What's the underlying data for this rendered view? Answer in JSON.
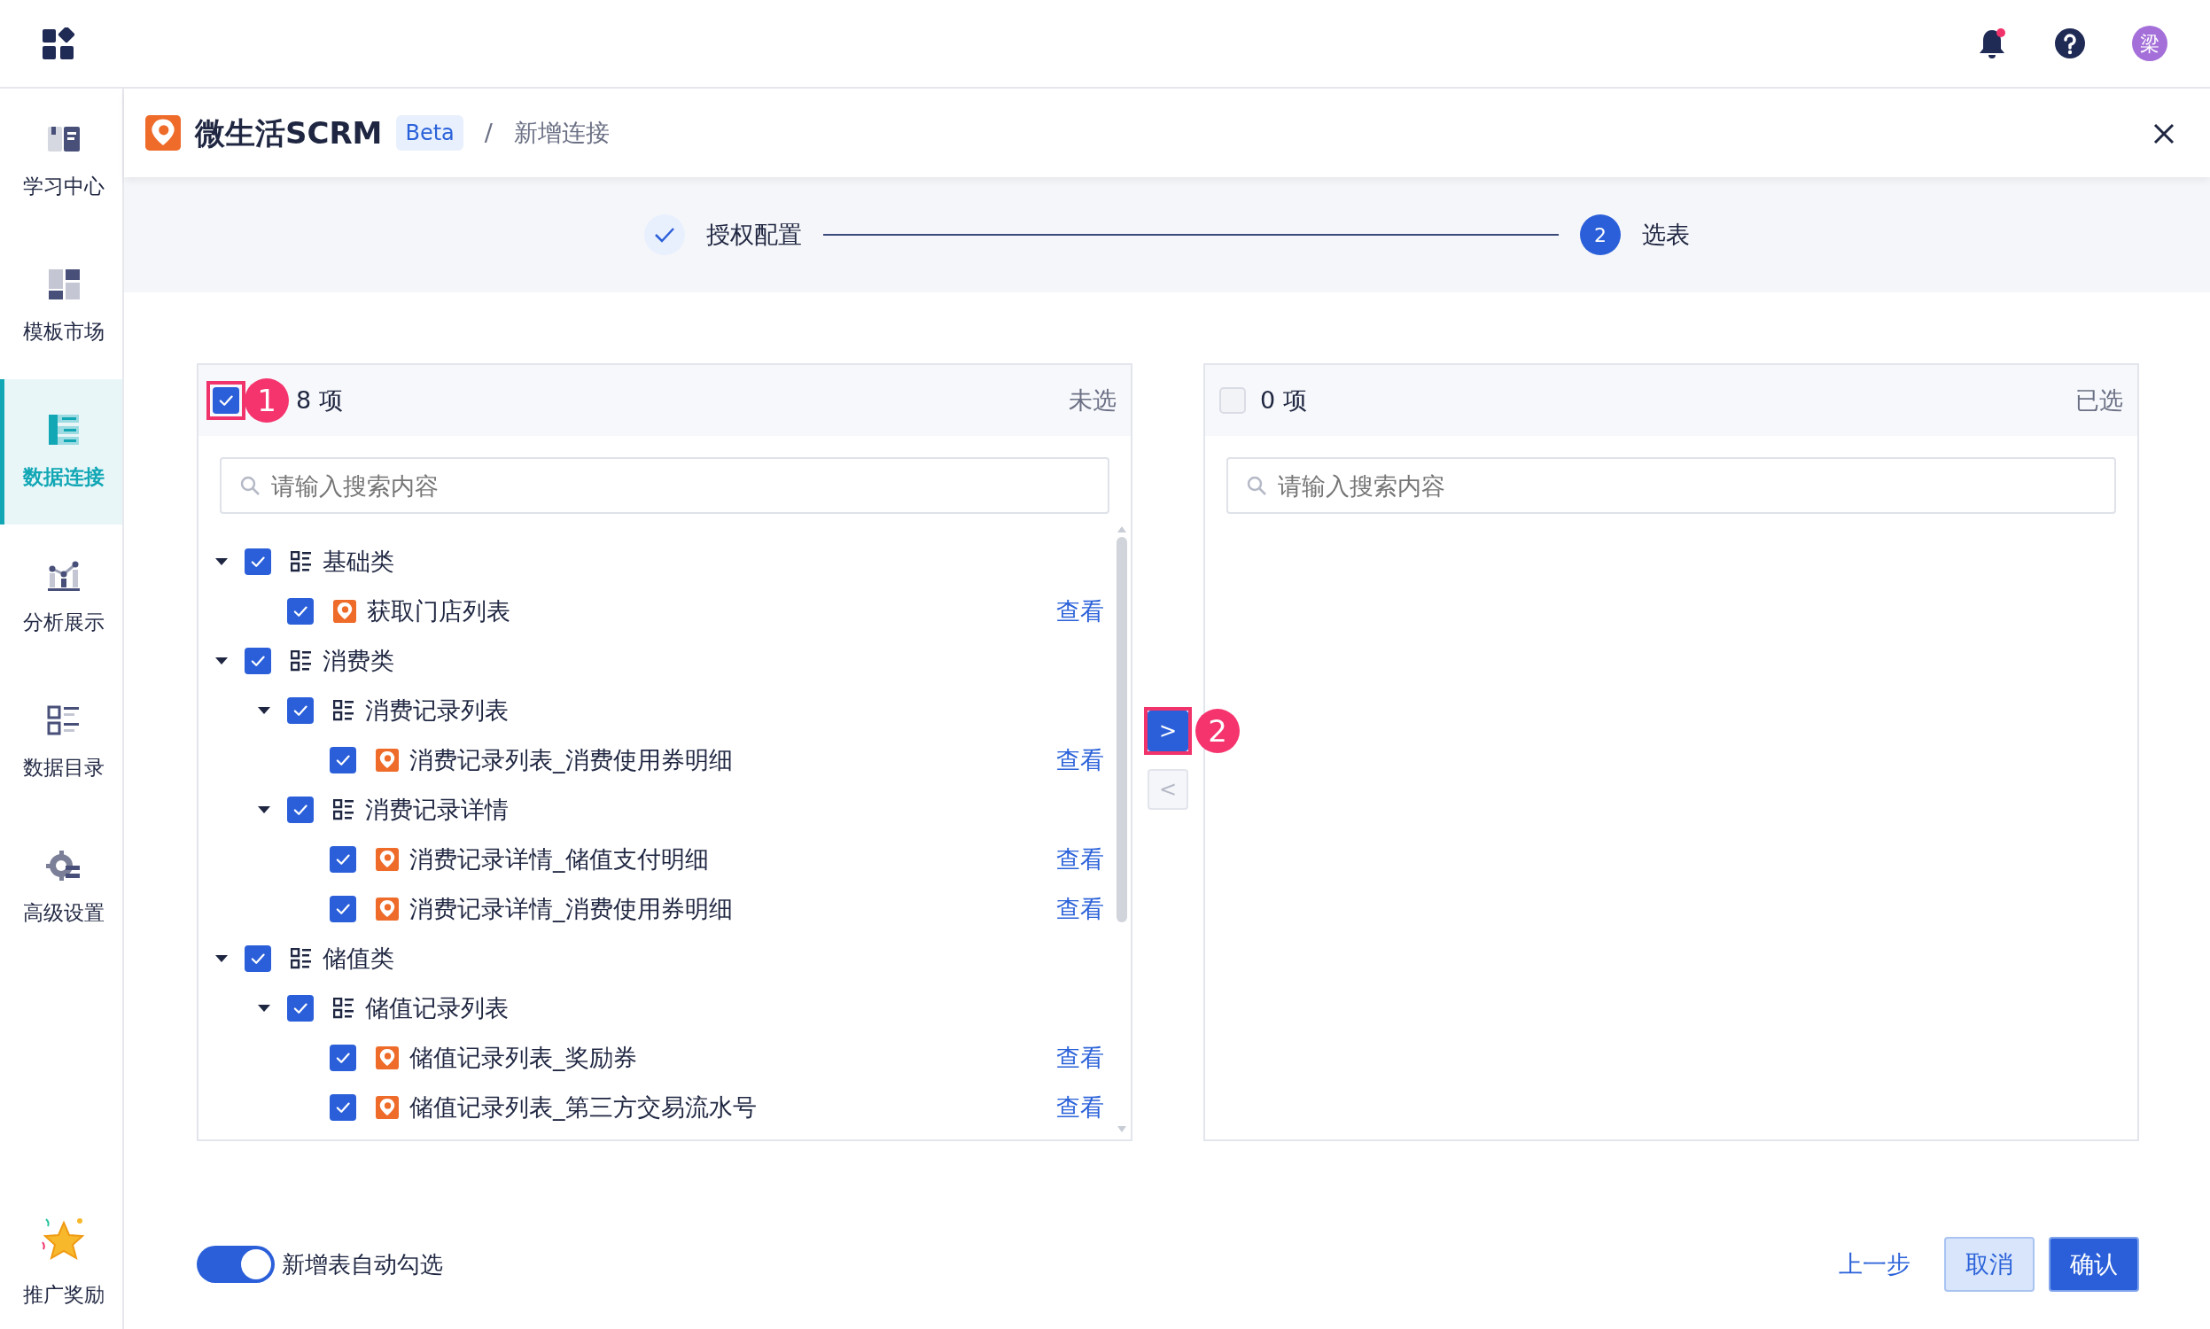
{
  "topbar": {
    "avatar": "梁",
    "notification_dot": true
  },
  "sidebar": {
    "items": [
      {
        "label": "学习中心",
        "selected": false
      },
      {
        "label": "模板市场",
        "selected": false
      },
      {
        "label": "数据连接",
        "selected": true
      },
      {
        "label": "分析展示",
        "selected": false
      },
      {
        "label": "数据目录",
        "selected": false
      },
      {
        "label": "高级设置",
        "selected": false
      }
    ],
    "footer_item": {
      "label": "推广奖励"
    }
  },
  "header": {
    "app_name": "微生活SCRM",
    "badge": "Beta",
    "separator": "/",
    "page": "新增连接"
  },
  "steps": [
    {
      "label": "授权配置",
      "done": true,
      "selected": false
    },
    {
      "label": "选表",
      "done": false,
      "selected": true,
      "number": "2"
    }
  ],
  "source_panel": {
    "checked": true,
    "count": "8 项",
    "title": "未选",
    "annotation": "1",
    "search": {
      "placeholder": "请输入搜索内容"
    },
    "tree": [
      {
        "label": "基础类",
        "kind": "folder",
        "checked": true,
        "expanded": true,
        "children": [
          {
            "label": "获取门店列表",
            "kind": "table",
            "checked": true,
            "action": "查看"
          }
        ]
      },
      {
        "label": "消费类",
        "kind": "folder",
        "checked": true,
        "expanded": true,
        "children": [
          {
            "label": "消费记录列表",
            "kind": "folder",
            "checked": true,
            "expanded": true,
            "children": [
              {
                "label": "消费记录列表_消费使用券明细",
                "kind": "table",
                "checked": true,
                "action": "查看"
              }
            ]
          },
          {
            "label": "消费记录详情",
            "kind": "folder",
            "checked": true,
            "expanded": true,
            "children": [
              {
                "label": "消费记录详情_储值支付明细",
                "kind": "table",
                "checked": true,
                "action": "查看"
              },
              {
                "label": "消费记录详情_消费使用券明细",
                "kind": "table",
                "checked": true,
                "action": "查看"
              }
            ]
          }
        ]
      },
      {
        "label": "储值类",
        "kind": "folder",
        "checked": true,
        "expanded": true,
        "children": [
          {
            "label": "储值记录列表",
            "kind": "folder",
            "checked": true,
            "expanded": true,
            "children": [
              {
                "label": "储值记录列表_奖励券",
                "kind": "table",
                "checked": true,
                "action": "查看"
              },
              {
                "label": "储值记录列表_第三方交易流水号",
                "kind": "table",
                "checked": true,
                "action": "查看"
              }
            ]
          }
        ]
      }
    ]
  },
  "transfer_buttons": [
    {
      "label": ">",
      "disabled": false,
      "annotation": "2"
    },
    {
      "label": "<",
      "disabled": true
    }
  ],
  "target_panel": {
    "checked": false,
    "count": "0 项",
    "title": "已选",
    "search": {
      "placeholder": "请输入搜索内容"
    }
  },
  "footer": {
    "auto_select": {
      "label": "新增表自动勾选",
      "on": true
    },
    "buttons": [
      {
        "label": "上一步",
        "kind": "link"
      },
      {
        "label": "取消",
        "kind": "secondary"
      },
      {
        "label": "确认",
        "kind": "primary"
      }
    ]
  }
}
